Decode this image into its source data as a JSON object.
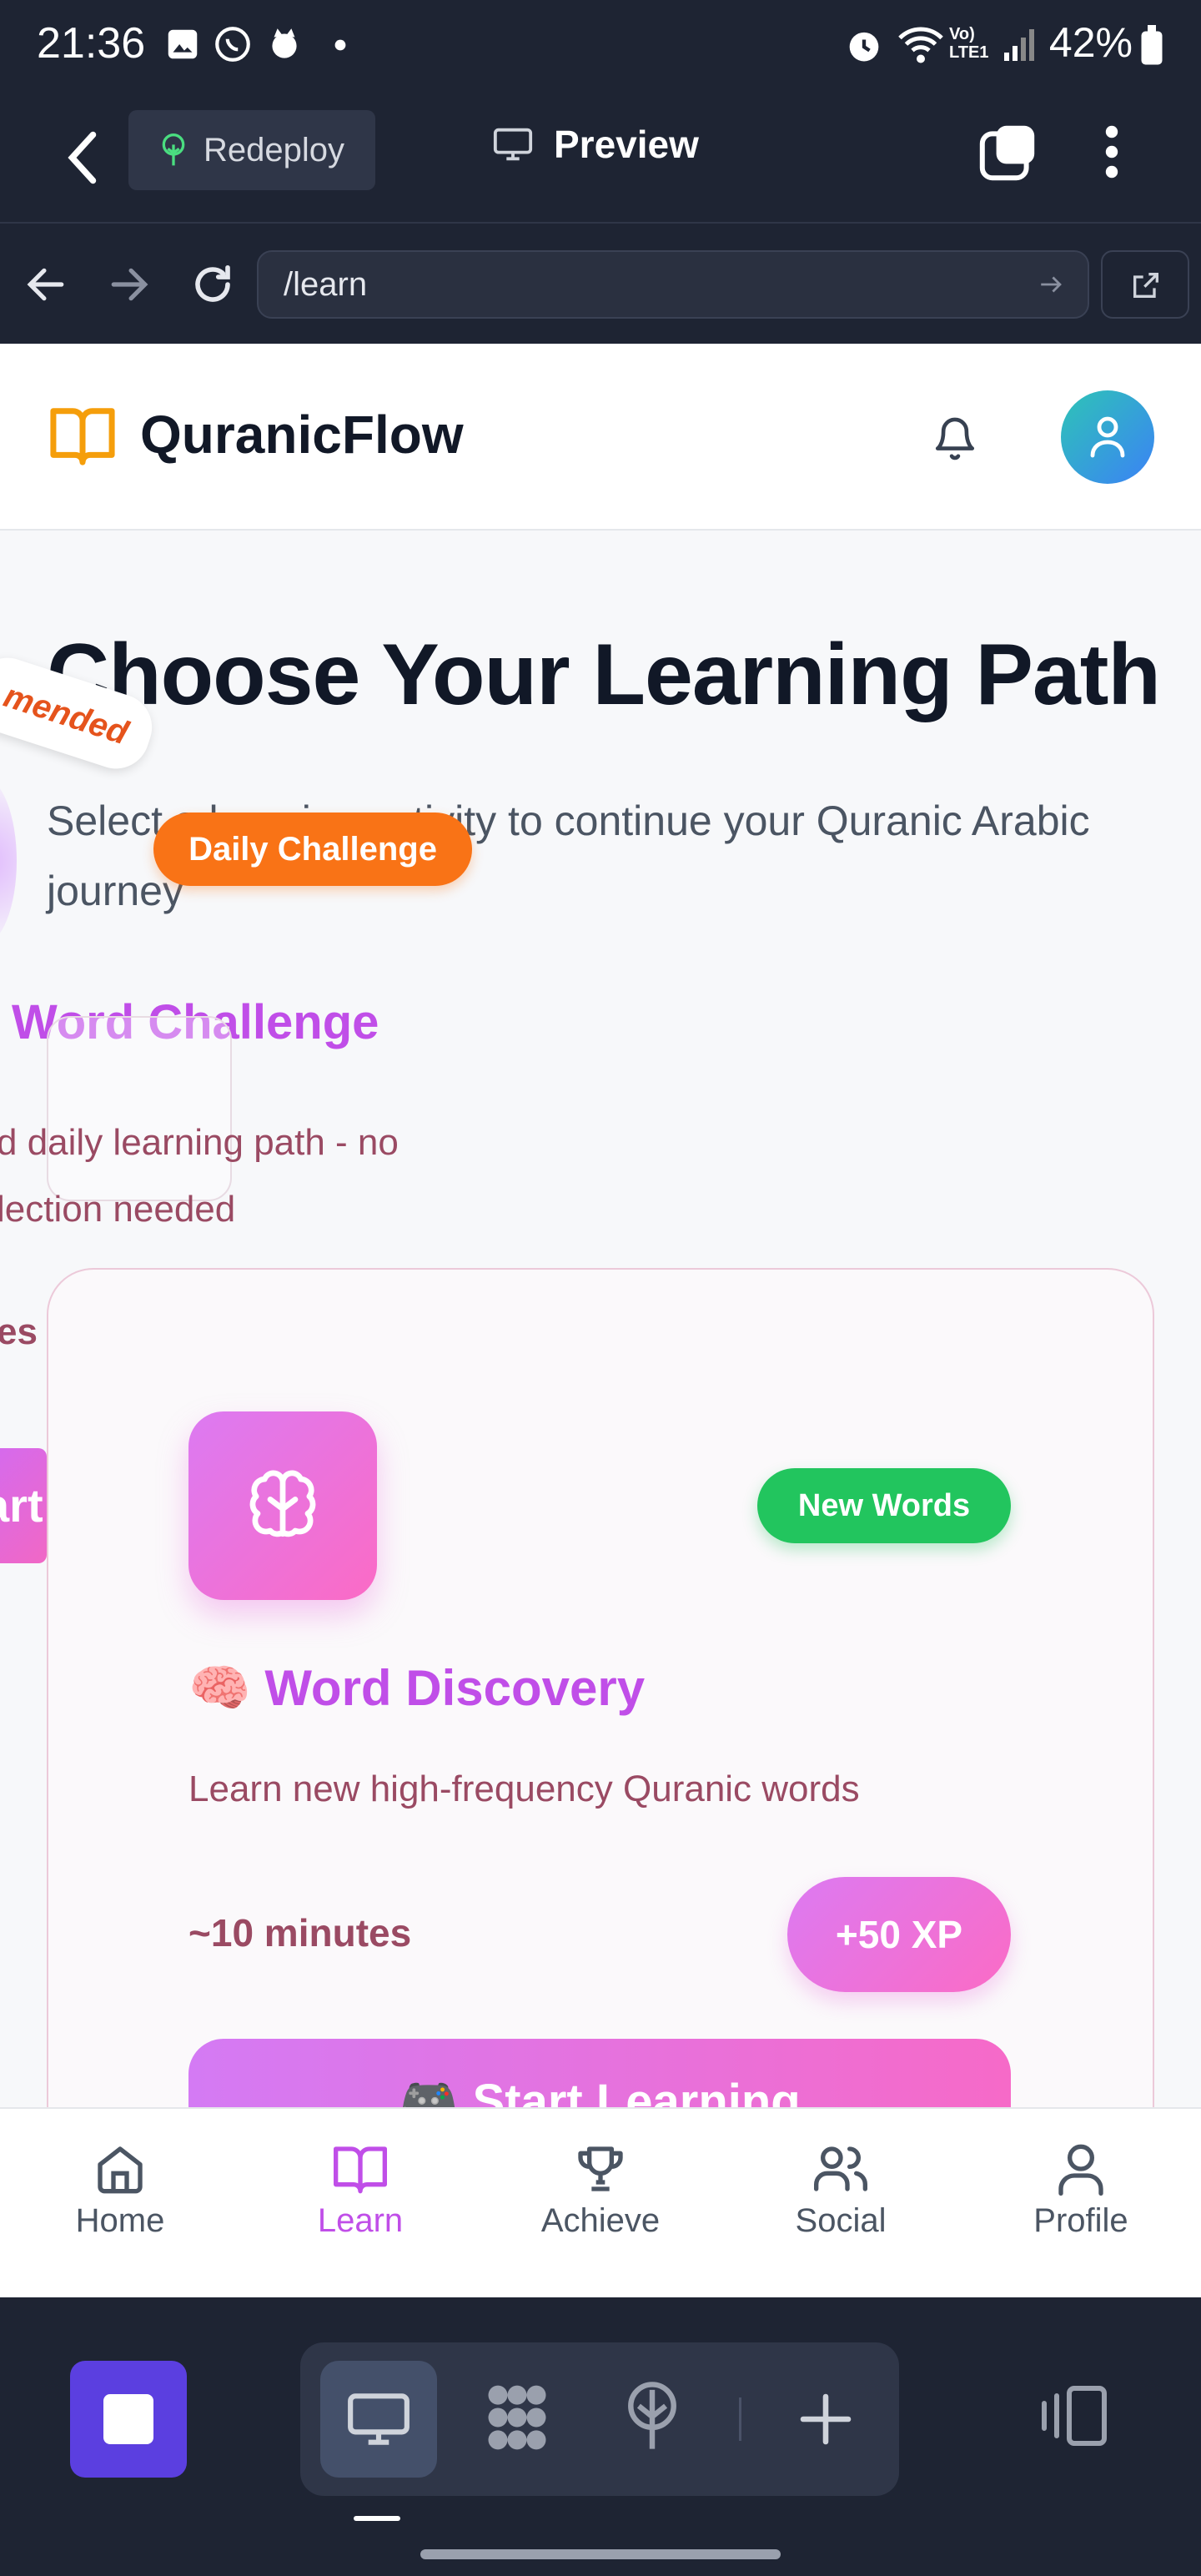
{
  "status_bar": {
    "time": "21:36",
    "battery": "42%"
  },
  "toolbar": {
    "redeploy_label": "Redeploy",
    "preview_label": "Preview"
  },
  "address_bar": {
    "url": "/learn"
  },
  "site": {
    "brand": "QuranicFlow"
  },
  "page": {
    "title": "Choose Your Learning Path",
    "subtitle": "Select a learning activity to continue your Quranic Arabic journey"
  },
  "carousel_prev_card": {
    "title": "Word Challenge",
    "desc_line1": "d daily learning path - no",
    "desc_line2": "lection needed",
    "minutes": "es",
    "button": "art",
    "badge": "mended",
    "daily_badge": "Daily Challenge"
  },
  "card": {
    "badge": "New Words",
    "title": "🧠 Word Discovery",
    "description": "Learn new high-frequency Quranic words",
    "duration": "~10 minutes",
    "xp": "+50 XP",
    "button": "🎮 Start Learning"
  },
  "bottom_nav": [
    {
      "label": "Home",
      "icon": "home-icon",
      "active": false
    },
    {
      "label": "Learn",
      "icon": "book-icon",
      "active": true
    },
    {
      "label": "Achieve",
      "icon": "trophy-icon",
      "active": false
    },
    {
      "label": "Social",
      "icon": "users-icon",
      "active": false
    },
    {
      "label": "Profile",
      "icon": "user-icon",
      "active": false
    }
  ],
  "colors": {
    "accent": "#c04ee8",
    "orange": "#f97316",
    "green": "#22c55e",
    "dark": "#1e2433"
  }
}
